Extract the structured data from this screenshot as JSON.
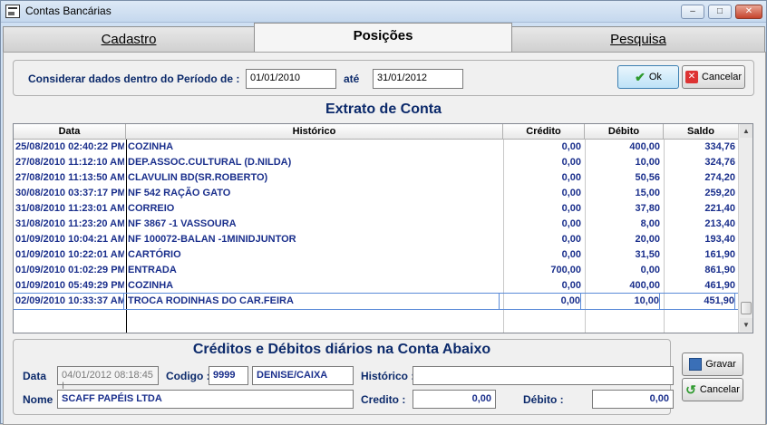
{
  "window": {
    "title": "Contas Bancárias",
    "min": "–",
    "max": "□",
    "close": "✕"
  },
  "tabs": [
    {
      "label": "Cadastro"
    },
    {
      "label": "Posições"
    },
    {
      "label": "Pesquisa"
    }
  ],
  "filter": {
    "label": "Considerar dados dentro do Período de :",
    "from": "01/01/2010",
    "until_label": "até",
    "to": "31/01/2012",
    "ok_label": "Ok",
    "cancel_label": "Cancelar"
  },
  "extrato": {
    "title": "Extrato de Conta",
    "columns": [
      "Data",
      "Histórico",
      "Crédito",
      "Débito",
      "Saldo"
    ],
    "rows": [
      [
        "25/08/2010 02:40:22 PM",
        "COZINHA",
        "0,00",
        "400,00",
        "334,76"
      ],
      [
        "27/08/2010 11:12:10 AM",
        "DEP.ASSOC.CULTURAL (D.NILDA)",
        "0,00",
        "10,00",
        "324,76"
      ],
      [
        "27/08/2010 11:13:50 AM",
        "CLAVULIN BD(SR.ROBERTO)",
        "0,00",
        "50,56",
        "274,20"
      ],
      [
        "30/08/2010 03:37:17 PM",
        "NF 542 RAÇÃO GATO",
        "0,00",
        "15,00",
        "259,20"
      ],
      [
        "31/08/2010 11:23:01 AM",
        "CORREIO",
        "0,00",
        "37,80",
        "221,40"
      ],
      [
        "31/08/2010 11:23:20 AM",
        "NF 3867 -1 VASSOURA",
        "0,00",
        "8,00",
        "213,40"
      ],
      [
        "01/09/2010 10:04:21 AM",
        "NF 100072-BALAN -1MINIDJUNTOR",
        "0,00",
        "20,00",
        "193,40"
      ],
      [
        "01/09/2010 10:22:01 AM",
        "CARTÓRIO",
        "0,00",
        "31,50",
        "161,90"
      ],
      [
        "01/09/2010 01:02:29 PM",
        "ENTRADA",
        "700,00",
        "0,00",
        "861,90"
      ],
      [
        "01/09/2010 05:49:29 PM",
        "COZINHA",
        "0,00",
        "400,00",
        "461,90"
      ],
      [
        "02/09/2010 10:33:37 AM",
        "TROCA RODINHAS DO CAR.FEIRA",
        "0,00",
        "10,00",
        "451,90"
      ]
    ]
  },
  "entry": {
    "title": "Créditos e Débitos diários na Conta Abaixo",
    "data_label": "Data",
    "data_value": "04/01/2012 08:18:45 I",
    "codigo_label": "Codigo :",
    "codigo_value": "9999",
    "conta_value": "DENISE/CAIXA",
    "historico_label": "Histórico :",
    "historico_value": "",
    "nome_label": "Nome",
    "nome_value": "SCAFF PAPÉIS LTDA",
    "credito_label": "Credito :",
    "credito_value": "0,00",
    "debito_label": "Débito :",
    "debito_value": "0,00",
    "gravar_label": "Gravar",
    "cancelar_label": "Cancelar"
  }
}
